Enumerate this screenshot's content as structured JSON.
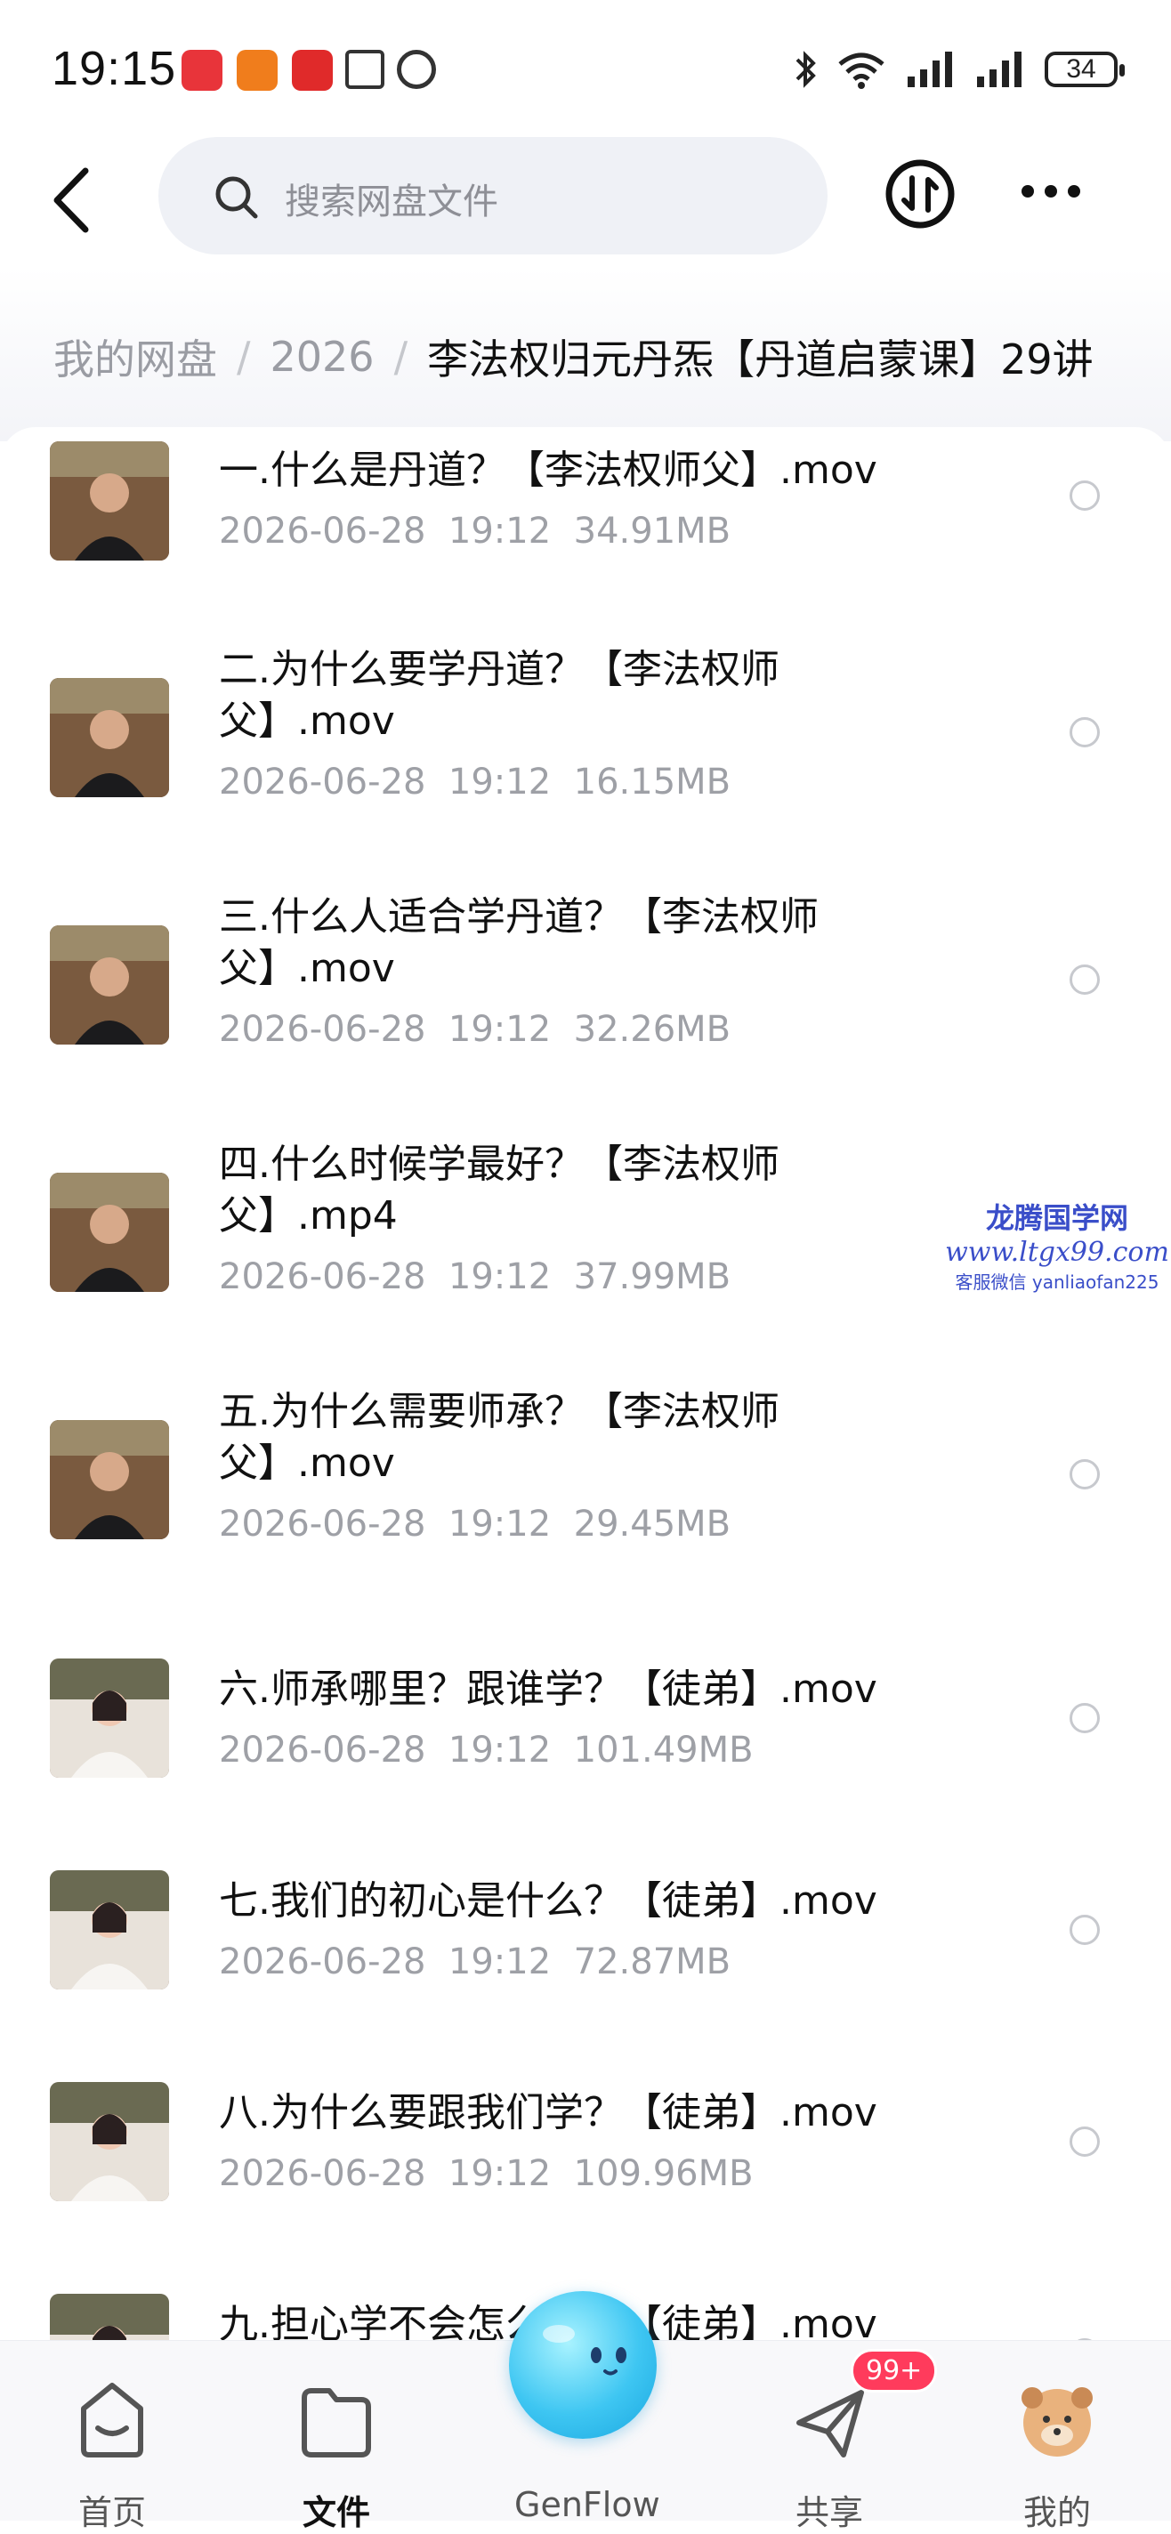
{
  "status_bar": {
    "time": "19:15",
    "battery": "34",
    "icons": [
      "huawei-app-icon",
      "shop-app-icon",
      "video-app-icon",
      "nfc-icon",
      "alarm-icon",
      "bluetooth-icon",
      "wifi-icon",
      "signal-icon",
      "signal-icon",
      "battery-icon"
    ]
  },
  "header": {
    "search_placeholder": "搜索网盘文件",
    "icons": [
      "back-icon",
      "search-icon",
      "transfer-icon",
      "more-icon"
    ]
  },
  "breadcrumb": {
    "root": "我的网盘",
    "level1": "2026",
    "current": "李法权归元丹炁【丹道启蒙课】29讲"
  },
  "files": [
    {
      "name": "一.什么是丹道？【李法权师父】.mov",
      "date": "2026-06-28",
      "time": "19:12",
      "size": "34.91MB"
    },
    {
      "name": "二.为什么要学丹道？【李法权师父】.mov",
      "date": "2026-06-28",
      "time": "19:12",
      "size": "16.15MB"
    },
    {
      "name": "三.什么人适合学丹道？【李法权师父】.mov",
      "date": "2026-06-28",
      "time": "19:12",
      "size": "32.26MB"
    },
    {
      "name": "四.什么时候学最好？【李法权师父】.mp4",
      "date": "2026-06-28",
      "time": "19:12",
      "size": "37.99MB"
    },
    {
      "name": "五.为什么需要师承？【李法权师父】.mov",
      "date": "2026-06-28",
      "time": "19:12",
      "size": "29.45MB"
    },
    {
      "name": "六.师承哪里？跟谁学？【徒弟】.mov",
      "date": "2026-06-28",
      "time": "19:12",
      "size": "101.49MB"
    },
    {
      "name": "七.我们的初心是什么？【徒弟】.mov",
      "date": "2026-06-28",
      "time": "19:12",
      "size": "72.87MB"
    },
    {
      "name": "八.为什么要跟我们学？【徒弟】.mov",
      "date": "2026-06-28",
      "time": "19:12",
      "size": "109.96MB"
    },
    {
      "name": "九.担心学不会怎么办？【徒弟】.mov",
      "date": "",
      "time": "",
      "size": ""
    }
  ],
  "watermark": {
    "line1": "龙腾国学网",
    "line2": "www.ltgx99.com",
    "line3": "客服微信 yanliaofan225"
  },
  "tabbar": {
    "tabs": [
      {
        "label": "首页"
      },
      {
        "label": "文件"
      },
      {
        "label": "GenFlow"
      },
      {
        "label": "共享"
      },
      {
        "label": "我的"
      }
    ],
    "share_badge": "99+",
    "active_tab": "文件"
  },
  "colors": {
    "accent_badge": "#ff3b5c",
    "genflow": "#3ec6f2",
    "watermark": "#3a4ec9",
    "muted_text": "#9ea0a6"
  }
}
